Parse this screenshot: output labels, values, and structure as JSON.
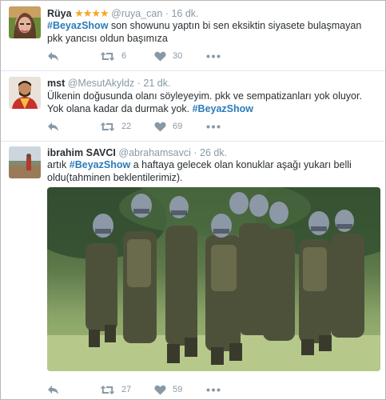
{
  "tweets": [
    {
      "name": "Rüya",
      "stars": "★★★★",
      "handle": "@ruya_can",
      "time": "16 dk.",
      "text_prefix": "",
      "hashtag": "#BeyazShow",
      "text_suffix": " son showunu yaptın bi sen eksiktin siyasete bulaşmayan pkk yancısı oldun başımıza",
      "retweets": "6",
      "likes": "30"
    },
    {
      "name": "mst",
      "handle": "@MesutAkyldz",
      "time": "21 dk.",
      "text_prefix": "Ülkenin doğusunda olanı söyleyeyim. pkk ve sempatizanları yok oluyor. Yok olana kadar da durmak yok. ",
      "hashtag": "#BeyazShow",
      "text_suffix": "",
      "retweets": "22",
      "likes": "69"
    },
    {
      "name": "ibrahim SAVCI",
      "handle": "@abrahamsavci",
      "time": "26 dk.",
      "text_prefix": "artık ",
      "hashtag": "#BeyazShow",
      "text_suffix": " a haftaya gelecek olan konuklar  aşağı yukarı belli oldu(tahminen beklentilerimiz).",
      "retweets": "27",
      "likes": "59"
    }
  ],
  "separator": "·",
  "colors": {
    "link": "#2b7bb9",
    "muted": "#8899a6",
    "text": "#292f33",
    "star": "#f5a623"
  },
  "icons": [
    "reply-icon",
    "retweet-icon",
    "heart-icon",
    "more-icon"
  ]
}
